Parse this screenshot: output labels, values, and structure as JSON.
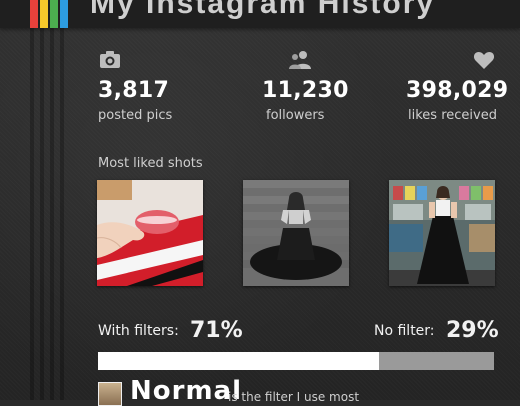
{
  "header": {
    "title": "My Instagram History",
    "stripe_colors": [
      "#e8413b",
      "#f7c82b",
      "#4cae4f",
      "#2d9ce0"
    ]
  },
  "stats": [
    {
      "icon": "camera-icon",
      "value": "3,817",
      "label": "posted pics"
    },
    {
      "icon": "followers-icon",
      "value": "11,230",
      "label": "followers"
    },
    {
      "icon": "heart-icon",
      "value": "398,029",
      "label": "likes received"
    }
  ],
  "most_liked": {
    "title": "Most liked shots",
    "photos": [
      {
        "subject": "pink macaron held in hand"
      },
      {
        "subject": "woman in black gown on stairs (black and white)"
      },
      {
        "subject": "woman in black dress at market stand"
      }
    ]
  },
  "filters": {
    "with_label": "With filters:",
    "with_value": "71%",
    "with_fraction": 0.71,
    "without_label": "No filter:",
    "without_value": "29%",
    "bar_fill_color": "#ffffff",
    "bar_track_color": "#9a9a9a"
  },
  "favorite_filter": {
    "name": "Normal",
    "note": "is the filter I use most"
  }
}
